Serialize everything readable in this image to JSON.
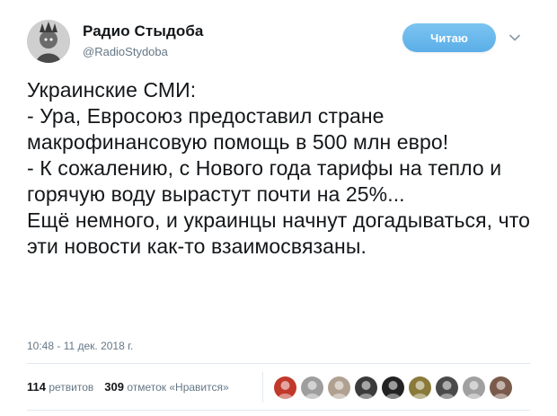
{
  "author": {
    "display_name": "Радио Стыдоба",
    "handle": "@RadioStydoba"
  },
  "follow_button": {
    "label": "Читаю"
  },
  "tweet": {
    "text": "Украинские СМИ:\n- Ура, Евросоюз предоставил стране макрофинансовую помощь в 500 млн евро!\n- К сожалению, с Нового года тарифы на тепло и горячую воду вырастут почти на 25%...\nЕщё немного, и украинцы начнут догадываться, что эти новости как-то взаимосвязаны.",
    "timestamp": "10:48 - 11 дек. 2018 г."
  },
  "stats": {
    "retweets_count": "114",
    "retweets_label": "ретвитов",
    "likes_count": "309",
    "likes_label": "отметок «Нравится»"
  },
  "likers": [
    {
      "icon": "liker-avatar-1",
      "color": "#c0392b"
    },
    {
      "icon": "liker-avatar-2",
      "color": "#9e9e9e"
    },
    {
      "icon": "liker-avatar-3",
      "color": "#b0a090"
    },
    {
      "icon": "liker-avatar-4",
      "color": "#3b3b3b"
    },
    {
      "icon": "liker-avatar-5",
      "color": "#222222"
    },
    {
      "icon": "liker-avatar-6",
      "color": "#8a7a3a"
    },
    {
      "icon": "liker-avatar-7",
      "color": "#4a4a4a"
    },
    {
      "icon": "liker-avatar-8",
      "color": "#a0a0a0"
    },
    {
      "icon": "liker-avatar-9",
      "color": "#7a5a4a"
    }
  ],
  "colors": {
    "follow_button": "#5aaee8",
    "secondary_text": "#657786",
    "primary_text": "#14171a",
    "divider": "#e1e8ed"
  }
}
